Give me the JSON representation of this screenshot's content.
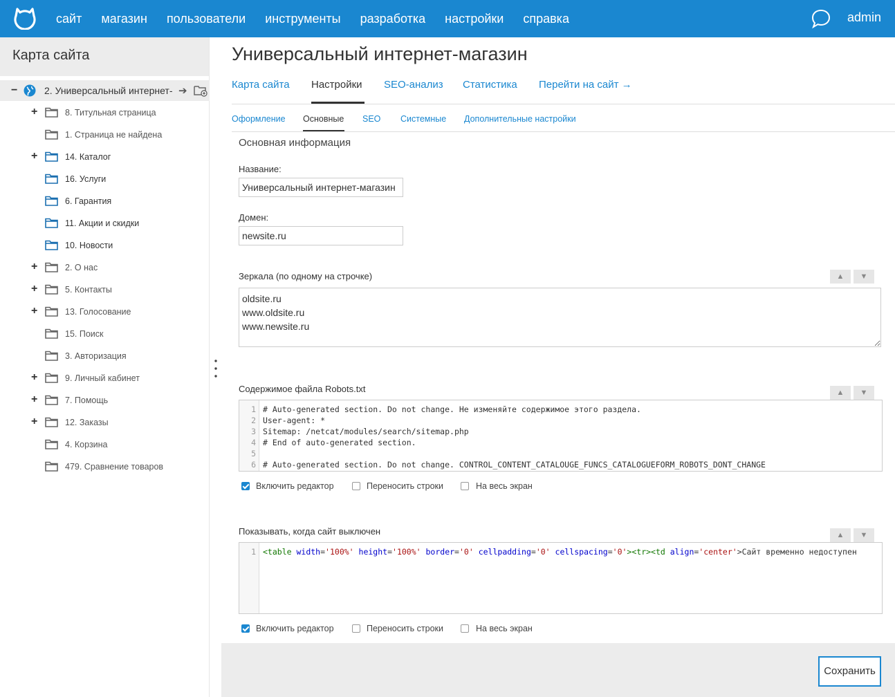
{
  "topbar": {
    "nav": [
      "сайт",
      "магазин",
      "пользователи",
      "инструменты",
      "разработка",
      "настройки",
      "справка"
    ],
    "user": "admin"
  },
  "sidebar": {
    "title": "Карта сайта",
    "root": "2. Универсальный интернет-",
    "items": [
      {
        "label": "8. Титульная страница",
        "expandable": true
      },
      {
        "label": "1. Страница не найдена",
        "expandable": false
      },
      {
        "label": "14. Каталог",
        "expandable": true
      },
      {
        "label": "16. Услуги",
        "expandable": false
      },
      {
        "label": "6. Гарантия",
        "expandable": false
      },
      {
        "label": "11. Акции и скидки",
        "expandable": false
      },
      {
        "label": "10. Новости",
        "expandable": false
      },
      {
        "label": "2. О нас",
        "expandable": true
      },
      {
        "label": "5. Контакты",
        "expandable": true
      },
      {
        "label": "13. Голосование",
        "expandable": true
      },
      {
        "label": "15. Поиск",
        "expandable": false
      },
      {
        "label": "3. Авторизация",
        "expandable": false
      },
      {
        "label": "9. Личный кабинет",
        "expandable": true
      },
      {
        "label": "7. Помощь",
        "expandable": true
      },
      {
        "label": "12. Заказы",
        "expandable": true
      },
      {
        "label": "4. Корзина",
        "expandable": false
      },
      {
        "label": "479. Сравнение товаров",
        "expandable": false
      }
    ]
  },
  "main": {
    "title": "Универсальный интернет-магазин",
    "tabs": [
      "Карта сайта",
      "Настройки",
      "SEO-анализ",
      "Статистика",
      "Перейти на сайт →"
    ],
    "active_tab": "Настройки",
    "subtabs": [
      "Оформление",
      "Основные",
      "SEO",
      "Системные",
      "Дополнительные настройки"
    ],
    "active_subtab": "Основные",
    "section_title": "Основная информация",
    "name_label": "Название:",
    "name_value": "Универсальный интернет-магазин",
    "domain_label": "Домен:",
    "domain_value": "newsite.ru",
    "mirrors_label": "Зеркала (по одному на строчке)",
    "mirrors_value": "oldsite.ru\nwww.oldsite.ru\nwww.newsite.ru",
    "robots_label": "Содержимое файла Robots.txt",
    "robots_lines": [
      "# Auto-generated section. Do not change. Не изменяйте содержимое этого раздела.",
      "User-agent: *",
      "Sitemap: /netcat/modules/search/sitemap.php",
      "# End of auto-generated section.",
      "",
      "# Auto-generated section. Do not change. CONTROL_CONTENT_CATALOUGE_FUNCS_CATALOGUEFORM_ROBOTS_DONT_CHANGE"
    ],
    "offline_label": "Показывать, когда сайт выключен",
    "offline_code": {
      "tag_open": "<table",
      "attrs": [
        {
          "name": "width",
          "value": "'100%'"
        },
        {
          "name": "height",
          "value": "'100%'"
        },
        {
          "name": "border",
          "value": "'0'"
        },
        {
          "name": "cellpadding",
          "value": "'0'"
        },
        {
          "name": "cellspacing",
          "value": "'0'"
        }
      ],
      "tail_tags": "><tr><td",
      "align_attr": {
        "name": "align",
        "value": "'center'"
      },
      "text": ">Сайт временно недоступен"
    },
    "options": {
      "enable_editor": "Включить редактор",
      "wrap_lines": "Переносить строки",
      "fullscreen": "На весь экран"
    },
    "save_label": "Сохранить"
  },
  "colors": {
    "accent": "#1a87d0",
    "sidebar_header": "#ececec"
  }
}
